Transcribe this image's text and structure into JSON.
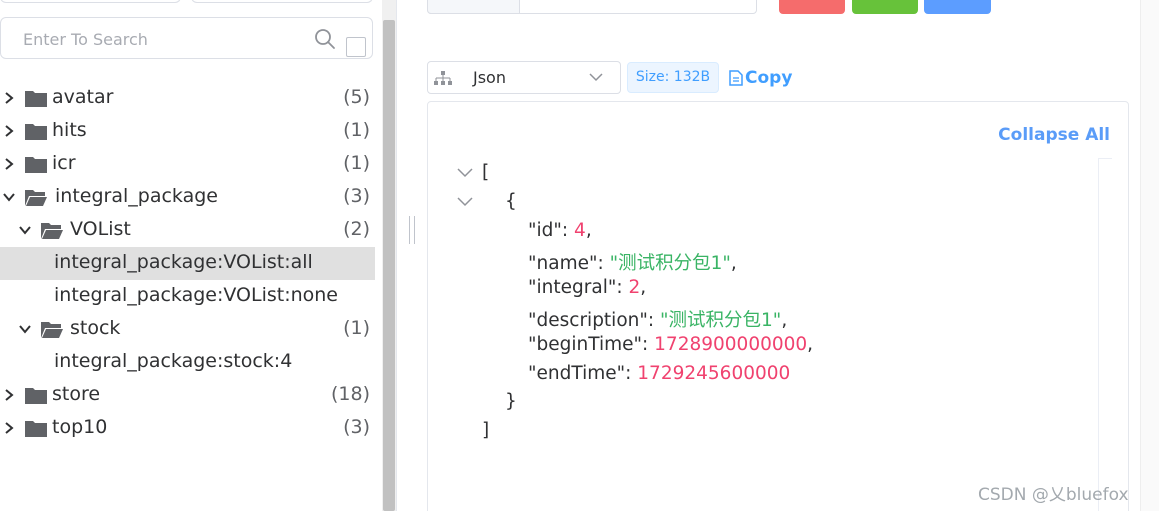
{
  "search": {
    "placeholder": "Enter To Search"
  },
  "tree": {
    "items": [
      {
        "label": "avatar",
        "count": "(5)"
      },
      {
        "label": "hits",
        "count": "(1)"
      },
      {
        "label": "icr",
        "count": "(1)"
      },
      {
        "label": "integral_package",
        "count": "(3)"
      },
      {
        "label": "VOList",
        "count": "(2)"
      },
      {
        "label": "integral_package:VOList:all",
        "count": ""
      },
      {
        "label": "integral_package:VOList:none",
        "count": ""
      },
      {
        "label": "stock",
        "count": "(1)"
      },
      {
        "label": "integral_package:stock:4",
        "count": ""
      },
      {
        "label": "store",
        "count": "(18)"
      },
      {
        "label": "top10",
        "count": "(3)"
      }
    ]
  },
  "viewer": {
    "format": "Json",
    "size": "Size: 132B",
    "copy_label": "Copy",
    "collapse_all": "Collapse All"
  },
  "json": {
    "open_bracket": "[",
    "open_brace": "{",
    "close_brace": "}",
    "close_bracket": "]",
    "id_key": "\"id\"",
    "id_val": "4",
    "name_key": "\"name\"",
    "name_val": "\"测试积分包1\"",
    "integral_key": "\"integral\"",
    "integral_val": "2",
    "description_key": "\"description\"",
    "description_val": "\"测试积分包1\"",
    "beginTime_key": "\"beginTime\"",
    "beginTime_val": "1728900000000",
    "endTime_key": "\"endTime\"",
    "endTime_val": "1729245600000"
  },
  "watermark": "CSDN @乂bluefox",
  "colors": {
    "accent": "#409eff",
    "number": "#f0426f",
    "string": "#3ab465",
    "danger": "#f56c6c",
    "success": "#67c23a"
  }
}
